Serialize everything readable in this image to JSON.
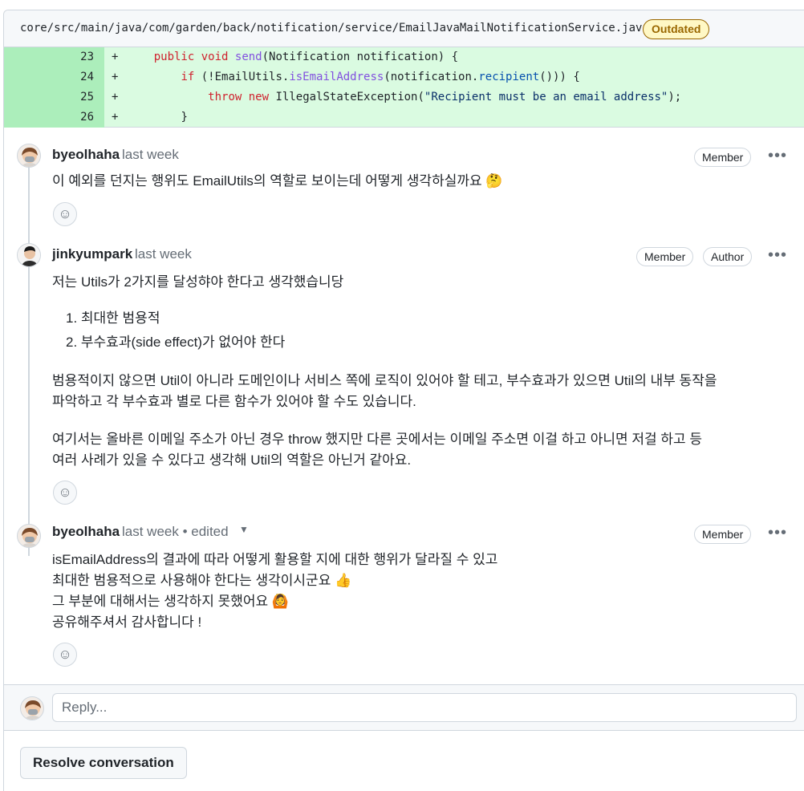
{
  "file": {
    "path": "core/src/main/java/com/garden/back/notification/service/EmailJavaMailNotificationService.java",
    "status_label": "Outdated"
  },
  "diff": {
    "lines": [
      {
        "number": "23",
        "marker": "+"
      },
      {
        "number": "24",
        "marker": "+"
      },
      {
        "number": "25",
        "marker": "+"
      },
      {
        "number": "26",
        "marker": "+"
      }
    ],
    "code": {
      "l23_kw1": "public",
      "l23_kw2": "void",
      "l23_fn": "send",
      "l23_rest": "(Notification notification) {",
      "l24_kw": "if",
      "l24_a": " (!EmailUtils.",
      "l24_fn": "isEmailAddress",
      "l24_b": "(notification.",
      "l24_prop": "recipient",
      "l24_c": "())) {",
      "l25_kw1": "throw",
      "l25_kw2": "new",
      "l25_a": " IllegalStateException(",
      "l25_str": "\"Recipient must be an email address\"",
      "l25_b": ");",
      "l26": "}"
    }
  },
  "comments": [
    {
      "author": "byeolhaha",
      "timestamp": "last week",
      "badges": [
        "Member"
      ],
      "body": [
        "이 예외를 던지는 행위도 EmailUtils의 역할로 보이는데 어떻게 생각하실까요 🤔"
      ]
    },
    {
      "author": "jinkyumpark",
      "timestamp": "last week",
      "badges": [
        "Member",
        "Author"
      ],
      "intro": "저는 Utils가 2가지를 달성햐야 한다고 생각했습니당",
      "list": [
        "1. 최대한 범용적",
        "2. 부수효과(side effect)가 없어야 한다"
      ],
      "para1": [
        "범용적이지 않으면 Util이 아니라 도메인이나 서비스 쪽에 로직이 있어야 할 테고, 부수효과가 있으면 Util의 내부 동작을",
        "파악하고 각 부수효과 별로 다른 함수가 있어야 할 수도 있습니다."
      ],
      "para2": [
        "여기서는 올바른 이메일 주소가 아닌 경우 throw 했지만 다른 곳에서는 이메일 주소면 이걸 하고 아니면 저걸 하고 등",
        "여러 사례가 있을 수 있다고 생각해 Util의 역할은 아닌거 같아요."
      ]
    },
    {
      "author": "byeolhaha",
      "timestamp": "last week • edited",
      "badges": [
        "Member"
      ],
      "body": [
        "isEmailAddress의 결과에 따라 어떻게 활용할 지에 대한 행위가 달라질 수 있고",
        "최대한 범용적으로 사용해야 한다는 생각이시군요 👍",
        "그 부분에 대해서는 생각하지 못했어요 🙆",
        "공유해주셔서 감사합니다 !"
      ]
    }
  ],
  "reply": {
    "placeholder": "Reply..."
  },
  "actions": {
    "resolve_label": "Resolve conversation"
  },
  "icons": {
    "more": "kebab-horizontal-icon",
    "reaction": "smiley-icon",
    "edited_menu": "triangle-down-icon"
  }
}
